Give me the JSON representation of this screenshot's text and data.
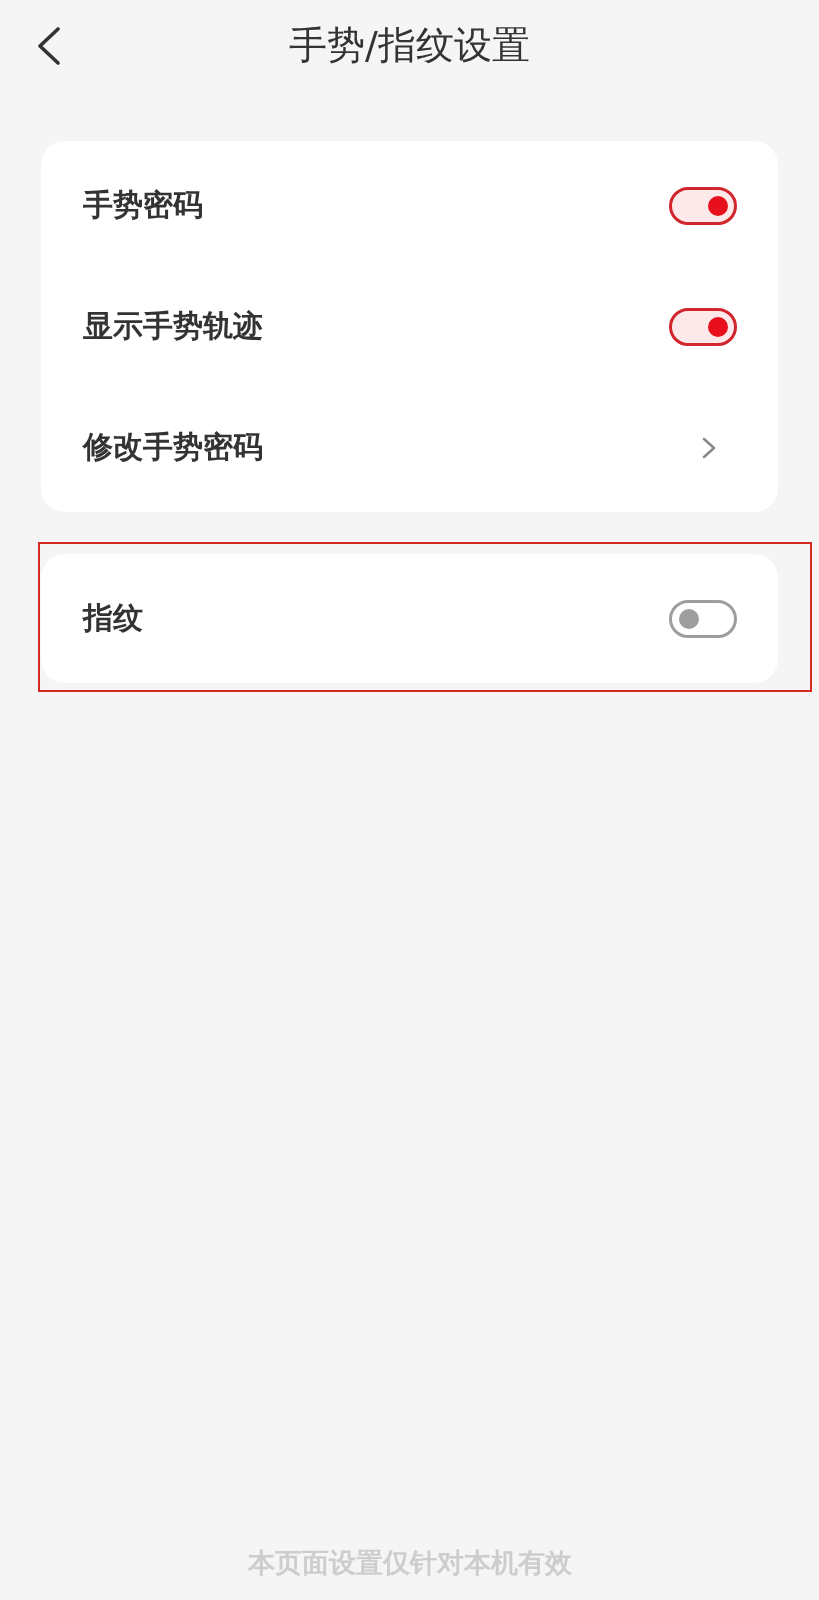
{
  "header": {
    "title": "手势/指纹设置"
  },
  "groups": [
    {
      "highlighted": false,
      "items": [
        {
          "kind": "toggle",
          "label": "手势密码",
          "on": true
        },
        {
          "kind": "toggle",
          "label": "显示手势轨迹",
          "on": true
        },
        {
          "kind": "link",
          "label": "修改手势密码"
        }
      ]
    },
    {
      "highlighted": true,
      "items": [
        {
          "kind": "toggle",
          "label": "指纹",
          "on": false
        }
      ]
    }
  ],
  "footer_note": "本页面设置仅针对本机有效"
}
